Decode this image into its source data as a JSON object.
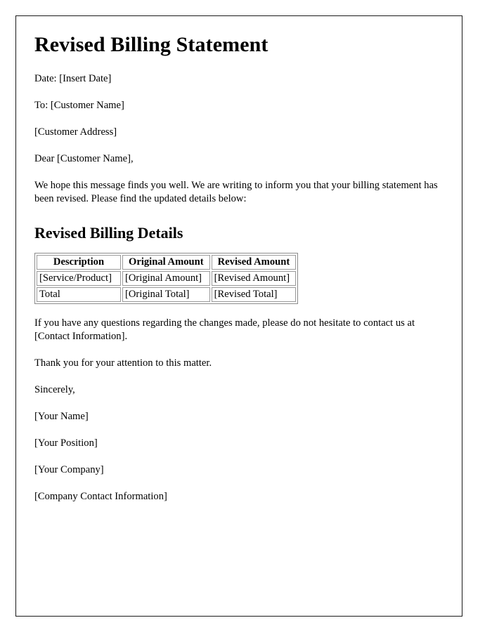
{
  "document": {
    "title": "Revised Billing Statement",
    "meta_lines": [
      "Date: [Insert Date]",
      "To: [Customer Name]",
      "[Customer Address]"
    ],
    "salutation": "Dear [Customer Name],",
    "intro_paragraph": "We hope this message finds you well. We are writing to inform you that your billing statement has been revised. Please find the updated details below:",
    "section_heading": "Revised Billing Details",
    "table": {
      "headers": [
        "Description",
        "Original Amount",
        "Revised Amount"
      ],
      "rows": [
        [
          "[Service/Product]",
          "[Original Amount]",
          "[Revised Amount]"
        ],
        [
          "Total",
          "[Original Total]",
          "[Revised Total]"
        ]
      ]
    },
    "questions_paragraph": "If you have any questions regarding the changes made, please do not hesitate to contact us at [Contact Information].",
    "thanks_paragraph": "Thank you for your attention to this matter.",
    "closing": "Sincerely,",
    "signature_lines": [
      "[Your Name]",
      "[Your Position]",
      "[Your Company]",
      "[Company Contact Information]"
    ]
  },
  "colors": {
    "page_border": "#1a1a1a",
    "text": "#000000",
    "table_border": "#8a8a8a",
    "background": "#ffffff"
  }
}
